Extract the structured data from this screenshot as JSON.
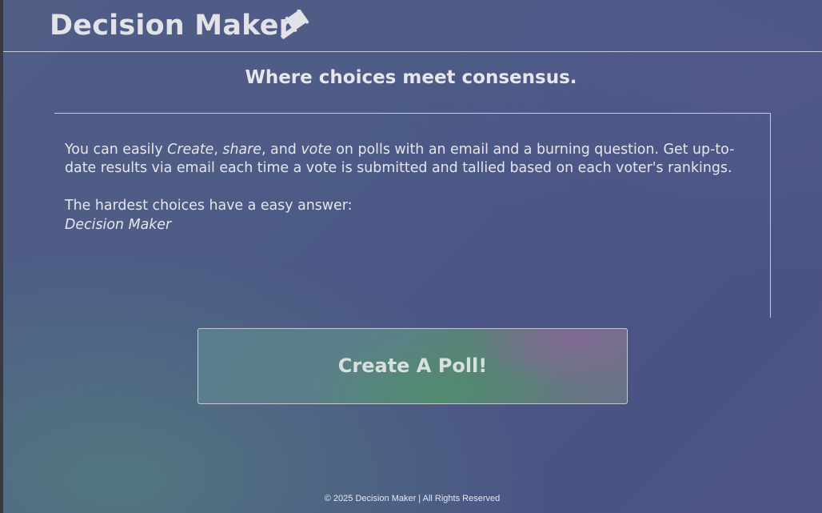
{
  "header": {
    "app_title": "Decision Maker",
    "logo_icon": "gavel-icon"
  },
  "main": {
    "tagline": "Where choices meet consensus.",
    "description": {
      "prefix": "You can easily ",
      "word_create": "Create",
      "sep1": ", ",
      "word_share": "share",
      "sep2": ", and ",
      "word_vote": "vote",
      "suffix": " on polls with an email and a burning question. Get up-to-date results via email each time a vote is submitted and tallied based on each voter's rankings."
    },
    "hardest_line": "The hardest choices have a easy answer:",
    "brand_line": "Decision Maker",
    "cta_label": "Create A Poll!"
  },
  "footer": {
    "copyright": "© 2025 Decision Maker | All Rights Reserved"
  },
  "colors": {
    "text": "#e6e6ec",
    "border": "#c6c8d6",
    "background": "#4d5a86",
    "cta_green": "#588276",
    "cta_purple": "#846896"
  }
}
